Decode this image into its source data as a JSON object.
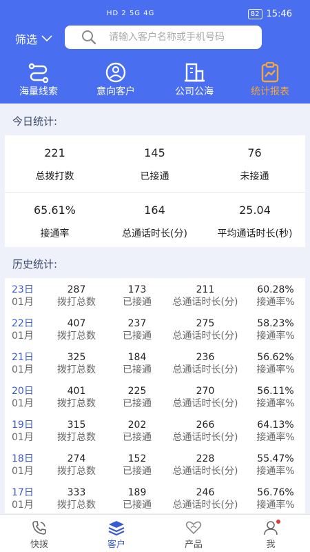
{
  "status_bar": {
    "network": "HD 2 5G 4G",
    "battery": "82",
    "time": "15:46"
  },
  "header": {
    "filter_label": "筛选",
    "search_placeholder": "请输入客户名称或手机号码"
  },
  "nav": [
    {
      "label": "海量线索",
      "icon": "clue-icon",
      "active": false
    },
    {
      "label": "意向客户",
      "icon": "customer-icon",
      "active": false
    },
    {
      "label": "公司公海",
      "icon": "building-icon",
      "active": false
    },
    {
      "label": "统计报表",
      "icon": "report-icon",
      "active": true
    }
  ],
  "today": {
    "title": "今日统计:",
    "stats": [
      {
        "value": "221",
        "label": "总拨打数"
      },
      {
        "value": "145",
        "label": "已接通"
      },
      {
        "value": "76",
        "label": "未接通"
      },
      {
        "value": "65.61%",
        "label": "接通率"
      },
      {
        "value": "164",
        "label": "总通话时长(分)"
      },
      {
        "value": "25.04",
        "label": "平均通话时长(秒)"
      }
    ]
  },
  "history": {
    "title": "历史统计:",
    "labels": {
      "day_unit": "日",
      "dial": "拨打总数",
      "connected": "已接通",
      "duration": "总通话时长(分)",
      "rate": "接通率%"
    },
    "rows": [
      {
        "day": "23",
        "month": "01月",
        "dial": "287",
        "connected": "173",
        "duration": "211",
        "rate": "60.28%"
      },
      {
        "day": "22",
        "month": "01月",
        "dial": "407",
        "connected": "237",
        "duration": "275",
        "rate": "58.23%"
      },
      {
        "day": "21",
        "month": "01月",
        "dial": "325",
        "connected": "184",
        "duration": "236",
        "rate": "56.62%"
      },
      {
        "day": "20",
        "month": "01月",
        "dial": "401",
        "connected": "225",
        "duration": "270",
        "rate": "56.11%"
      },
      {
        "day": "19",
        "month": "01月",
        "dial": "315",
        "connected": "202",
        "duration": "266",
        "rate": "64.13%"
      },
      {
        "day": "18",
        "month": "01月",
        "dial": "274",
        "connected": "152",
        "duration": "228",
        "rate": "55.47%"
      },
      {
        "day": "17",
        "month": "01月",
        "dial": "333",
        "connected": "189",
        "duration": "246",
        "rate": "56.76%"
      }
    ]
  },
  "tabbar": [
    {
      "label": "快拨",
      "icon": "phone-icon",
      "active": false
    },
    {
      "label": "客户",
      "icon": "layers-icon",
      "active": true
    },
    {
      "label": "产品",
      "icon": "heart-hand-icon",
      "active": false
    },
    {
      "label": "我",
      "icon": "user-icon",
      "active": false
    }
  ],
  "colors": {
    "primary": "#4a6ef0",
    "accent": "#f0a83a",
    "link": "#3a5ad0",
    "badge": "#e83a3a"
  }
}
